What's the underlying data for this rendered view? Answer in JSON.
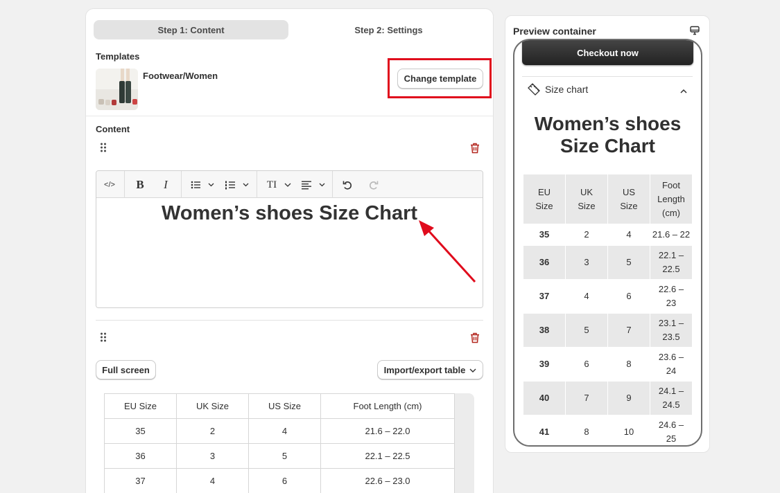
{
  "steps": {
    "step1": "Step 1: Content",
    "step2": "Step 2: Settings"
  },
  "templates": {
    "label": "Templates",
    "name": "Footwear/Women",
    "change_button": "Change template"
  },
  "content": {
    "label": "Content",
    "heading": "Women’s shoes Size Chart"
  },
  "toolbar": {
    "code": "</>",
    "bold": "B",
    "italic": "I",
    "text_size": "TI"
  },
  "table_controls": {
    "full_screen": "Full screen",
    "import_export": "Import/export table"
  },
  "editor_table": {
    "headers": [
      "EU Size",
      "UK Size",
      "US Size",
      "Foot Length (cm)"
    ],
    "rows": [
      [
        "35",
        "2",
        "4",
        "21.6 – 22.0"
      ],
      [
        "36",
        "3",
        "5",
        "22.1 – 22.5"
      ],
      [
        "37",
        "4",
        "6",
        "22.6 – 23.0"
      ]
    ]
  },
  "preview": {
    "title": "Preview container",
    "checkout": "Checkout now",
    "size_chart": "Size chart",
    "heading_line1": "Women’s shoes",
    "heading_line2": "Size Chart",
    "headers": [
      [
        "EU",
        "Size"
      ],
      [
        "UK",
        "Size"
      ],
      [
        "US",
        "Size"
      ],
      [
        "Foot",
        "Length",
        "(cm)"
      ]
    ],
    "rows": [
      [
        "35",
        "2",
        "4",
        "21.6 – 22"
      ],
      [
        "36",
        "3",
        "5",
        "22.1 –",
        "22.5"
      ],
      [
        "37",
        "4",
        "6",
        "22.6 –",
        "23"
      ],
      [
        "38",
        "5",
        "7",
        "23.1 –",
        "23.5"
      ],
      [
        "39",
        "6",
        "8",
        "23.6 –",
        "24"
      ],
      [
        "40",
        "7",
        "9",
        "24.1 –",
        "24.5"
      ],
      [
        "41",
        "8",
        "10",
        "24.6 –",
        "25"
      ]
    ]
  },
  "colors": {
    "highlight": "#e00b1c",
    "delete": "#b3261e"
  }
}
